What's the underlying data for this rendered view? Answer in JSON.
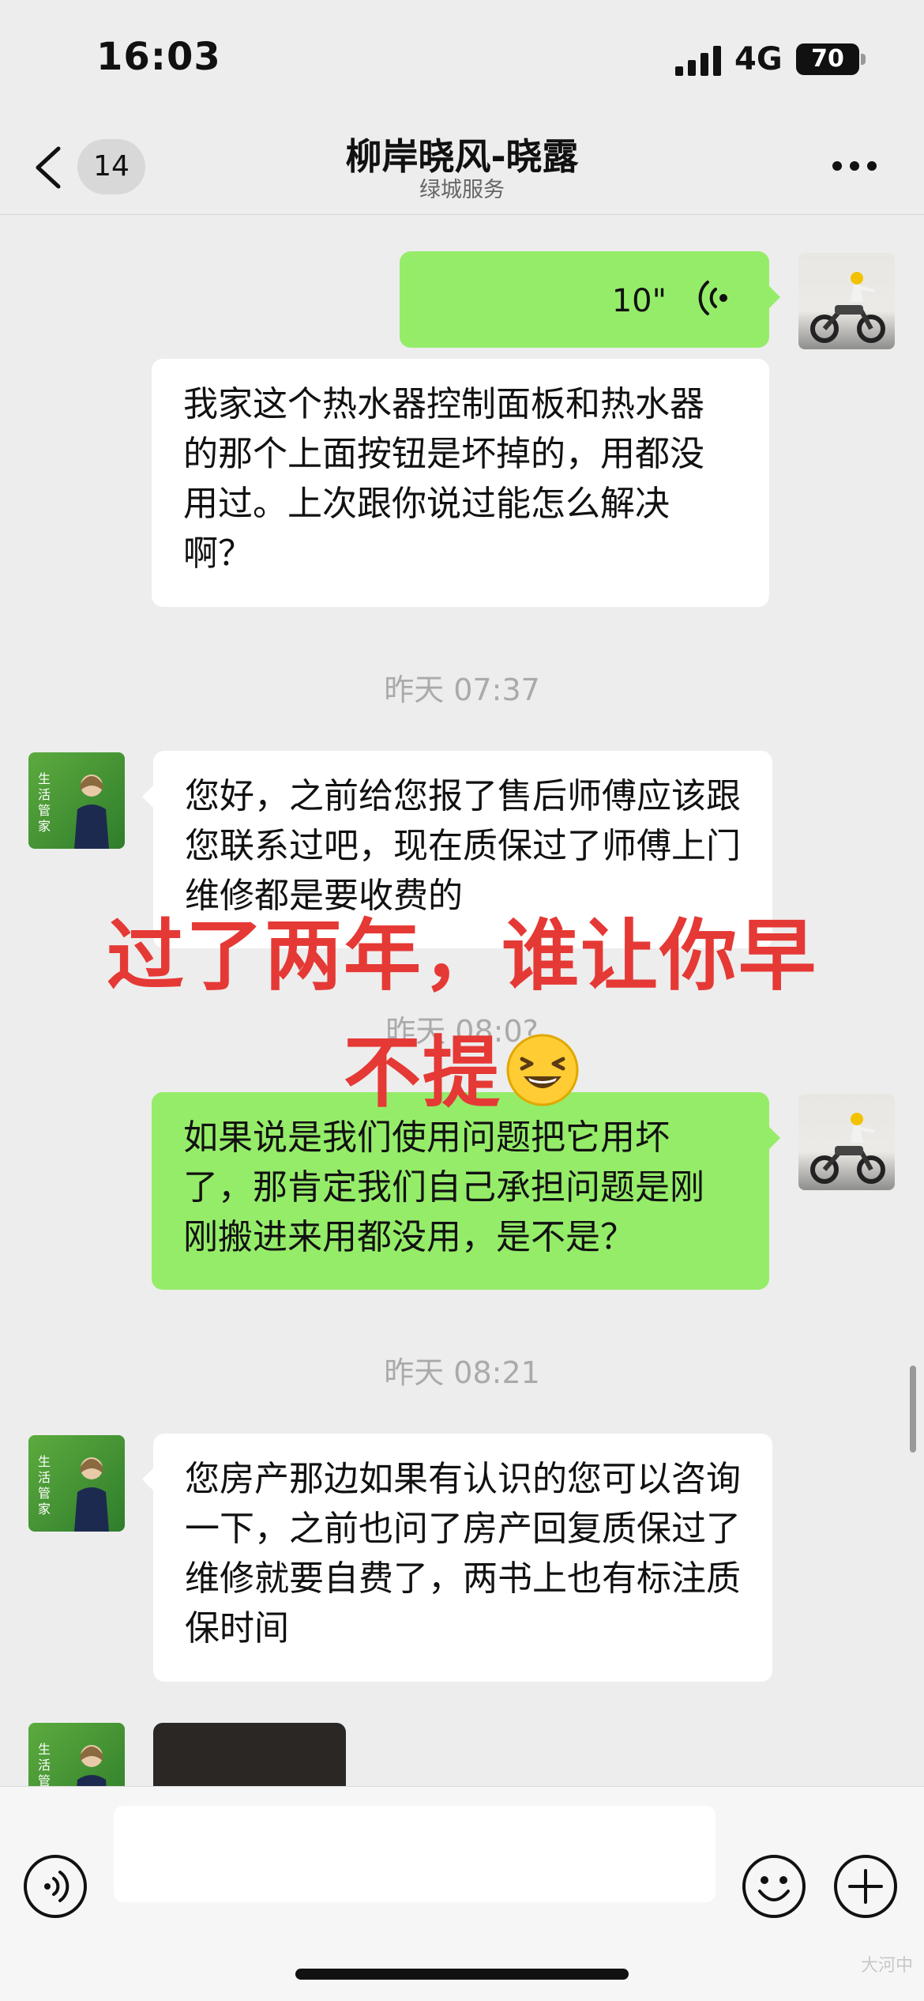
{
  "status_bar": {
    "time": "16:03",
    "network": "4G",
    "battery": "70"
  },
  "nav": {
    "unread_count": "14",
    "title": "柳岸晓风-晓露",
    "subtitle": "绿城服务"
  },
  "agent_avatar": {
    "line1": "生活",
    "line2": "管家"
  },
  "messages": [
    {
      "side": "right",
      "kind": "voice",
      "duration": "10\""
    },
    {
      "side": "right",
      "kind": "text",
      "text": "我家这个热水器控制面板和热水器的那个上面按钮是坏掉的，用都没用过。上次跟你说过能怎么解决啊？"
    },
    {
      "kind": "timestamp",
      "text": "昨天 07:37"
    },
    {
      "side": "left",
      "kind": "text",
      "text": "您好，之前给您报了售后师傅应该跟您联系过吧，现在质保过了师傅上门维修都是要收费的"
    },
    {
      "kind": "timestamp",
      "text": "昨天 08:0?"
    },
    {
      "side": "right",
      "kind": "text",
      "text": "如果说是我们使用问题把它用坏了，那肯定我们自己承担问题是刚刚搬进来用都没用，是不是？"
    },
    {
      "kind": "timestamp",
      "text": "昨天 08:21"
    },
    {
      "side": "left",
      "kind": "text",
      "text": "您房产那边如果有认识的您可以咨询一下，之前也问了房产回复质保过了维修就要自费了，两书上也有标注质保时间"
    },
    {
      "side": "left",
      "kind": "image"
    }
  ],
  "overlay": {
    "line1": "过了两年，谁让你早",
    "line2": "不提"
  },
  "watermark": "大河中"
}
